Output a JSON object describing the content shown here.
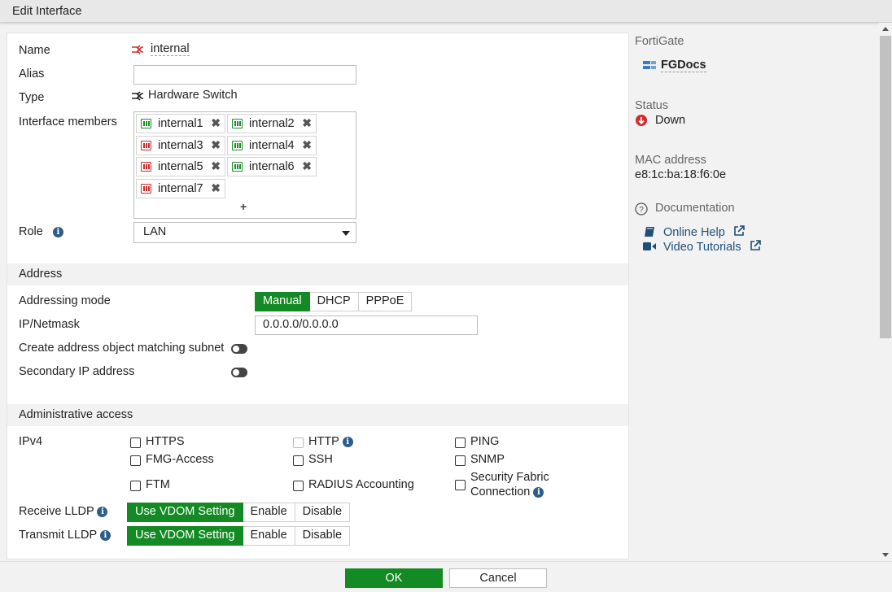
{
  "window": {
    "title": "Edit Interface"
  },
  "form": {
    "name_label": "Name",
    "name_value": "internal",
    "alias_label": "Alias",
    "alias_value": "",
    "type_label": "Type",
    "type_value": "Hardware Switch",
    "members_label": "Interface members",
    "members": [
      {
        "name": "internal1",
        "status": "up"
      },
      {
        "name": "internal2",
        "status": "up"
      },
      {
        "name": "internal3",
        "status": "down"
      },
      {
        "name": "internal4",
        "status": "up"
      },
      {
        "name": "internal5",
        "status": "down"
      },
      {
        "name": "internal6",
        "status": "up"
      },
      {
        "name": "internal7",
        "status": "down"
      }
    ],
    "add_member": "+",
    "role_label": "Role",
    "role_value": "LAN"
  },
  "address": {
    "section_title": "Address",
    "mode_label": "Addressing mode",
    "modes": [
      "Manual",
      "DHCP",
      "PPPoE"
    ],
    "mode_selected": "Manual",
    "ip_label": "IP/Netmask",
    "ip_value": "0.0.0.0/0.0.0.0",
    "create_obj_label": "Create address object matching subnet",
    "create_obj_enabled": false,
    "secondary_label": "Secondary IP address",
    "secondary_enabled": false
  },
  "admin": {
    "section_title": "Administrative access",
    "ipv4_label": "IPv4",
    "protocols": {
      "https": "HTTPS",
      "http": "HTTP",
      "ping": "PING",
      "fmg": "FMG-Access",
      "ssh": "SSH",
      "snmp": "SNMP",
      "ftm": "FTM",
      "radius": "RADIUS Accounting",
      "fabric_1": "Security Fabric",
      "fabric_2": "Connection"
    },
    "checked": [],
    "receive_lldp_label": "Receive LLDP",
    "transmit_lldp_label": "Transmit LLDP",
    "lldp_options": [
      "Use VDOM Setting",
      "Enable",
      "Disable"
    ],
    "receive_lldp_selected": "Use VDOM Setting",
    "transmit_lldp_selected": "Use VDOM Setting"
  },
  "sidebar": {
    "fortigate_label": "FortiGate",
    "fortigate_value": "FGDocs",
    "status_label": "Status",
    "status_value": "Down",
    "mac_label": "MAC address",
    "mac_value": "e8:1c:ba:18:f6:0e",
    "doc_label": "Documentation",
    "links": {
      "help": "Online Help",
      "video": "Video Tutorials"
    }
  },
  "footer": {
    "ok": "OK",
    "cancel": "Cancel"
  },
  "colors": {
    "accent": "#148a24",
    "link": "#1f4e79",
    "down": "#d12b2b",
    "up": "#1e8e2a"
  }
}
